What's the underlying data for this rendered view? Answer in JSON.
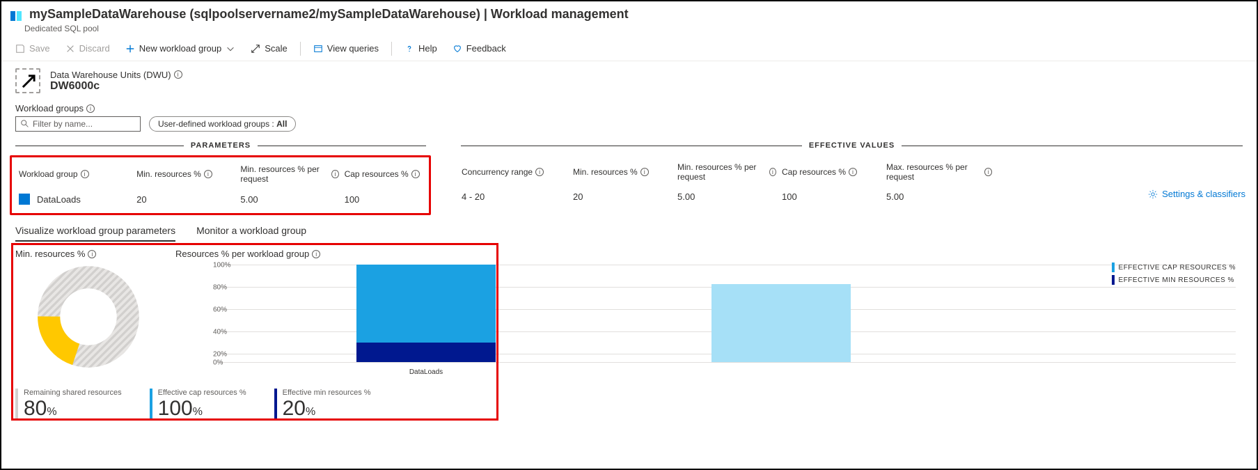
{
  "header": {
    "title": "mySampleDataWarehouse (sqlpoolservername2/mySampleDataWarehouse) | Workload management",
    "subtitle": "Dedicated SQL pool"
  },
  "toolbar": {
    "save": "Save",
    "discard": "Discard",
    "new_group": "New workload group",
    "scale": "Scale",
    "view_queries": "View queries",
    "help": "Help",
    "feedback": "Feedback"
  },
  "dwu": {
    "label": "Data Warehouse Units (DWU)",
    "value": "DW6000c"
  },
  "workload_groups": {
    "label": "Workload groups",
    "filter_placeholder": "Filter by name...",
    "pill_prefix": "User-defined workload groups : ",
    "pill_value": "All"
  },
  "sections": {
    "parameters": "PARAMETERS",
    "effective": "EFFECTIVE VALUES"
  },
  "table": {
    "headers": {
      "workload_group": "Workload group",
      "min_resources": "Min. resources %",
      "min_per_request": "Min. resources % per request",
      "cap_resources": "Cap resources %",
      "concurrency": "Concurrency range",
      "eff_min": "Min. resources %",
      "eff_min_req": "Min. resources % per request",
      "eff_cap": "Cap resources %",
      "eff_max_req": "Max. resources % per request"
    },
    "row": {
      "name": "DataLoads",
      "min_resources": "20",
      "min_per_request": "5.00",
      "cap_resources": "100",
      "concurrency": "4 - 20",
      "eff_min": "20",
      "eff_min_req": "5.00",
      "eff_cap": "100",
      "eff_max_req": "5.00"
    },
    "settings_link": "Settings & classifiers"
  },
  "tabs": {
    "visualize": "Visualize workload group parameters",
    "monitor": "Monitor a workload group"
  },
  "viz": {
    "min_title": "Min. resources %",
    "chart_title": "Resources % per workload group",
    "legend_cap": "EFFECTIVE CAP RESOURCES %",
    "legend_min": "EFFECTIVE MIN RESOURCES %",
    "yticks": {
      "t0": "0%",
      "t20": "20%",
      "t40": "40%",
      "t60": "60%",
      "t80": "80%",
      "t100": "100%"
    },
    "xlabel": "DataLoads"
  },
  "stats": {
    "remaining_label": "Remaining shared resources",
    "remaining_val": "80",
    "cap_label": "Effective cap resources %",
    "cap_val": "100",
    "min_label": "Effective min resources %",
    "min_val": "20",
    "pct": "%"
  },
  "chart_data": [
    {
      "type": "pie",
      "title": "Min. resources %",
      "series": [
        {
          "name": "Remaining shared resources",
          "value": 80,
          "color": "#d2d0ce"
        },
        {
          "name": "Min resources",
          "value": 20,
          "color": "#ffc800"
        }
      ]
    },
    {
      "type": "bar",
      "title": "Resources % per workload group",
      "categories": [
        "DataLoads"
      ],
      "series": [
        {
          "name": "EFFECTIVE CAP RESOURCES %",
          "values": [
            100
          ],
          "color": "#1ba1e2"
        },
        {
          "name": "EFFECTIVE MIN RESOURCES %",
          "values": [
            20
          ],
          "color": "#00188f"
        }
      ],
      "ylim": [
        0,
        100
      ],
      "ylabel": "%"
    }
  ]
}
